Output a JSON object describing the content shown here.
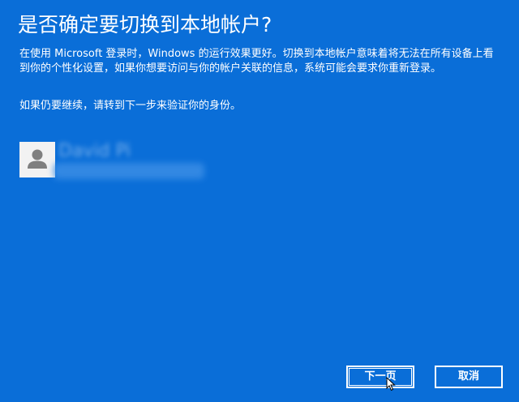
{
  "dialog": {
    "title": "是否确定要切换到本地帐户?",
    "description": "在使用 Microsoft 登录时，Windows 的运行效果更好。切换到本地帐户意味着将无法在所有设备上看到你的个性化设置，如果你想要访问与你的帐户关联的信息，系统可能会要求你重新登录。",
    "continue_text": "如果仍要继续，请转到下一步来验证你的身份。"
  },
  "account": {
    "name": "David Pi",
    "email_blurred": true
  },
  "buttons": {
    "next_label": "下一页",
    "cancel_label": "取消"
  },
  "colors": {
    "background": "#0a6ed8",
    "text": "#ffffff",
    "avatar_bg": "#f2f2f2",
    "avatar_icon": "#7f7f7f"
  },
  "icons": {
    "avatar": "person-icon",
    "cursor": "mouse-pointer-icon"
  }
}
